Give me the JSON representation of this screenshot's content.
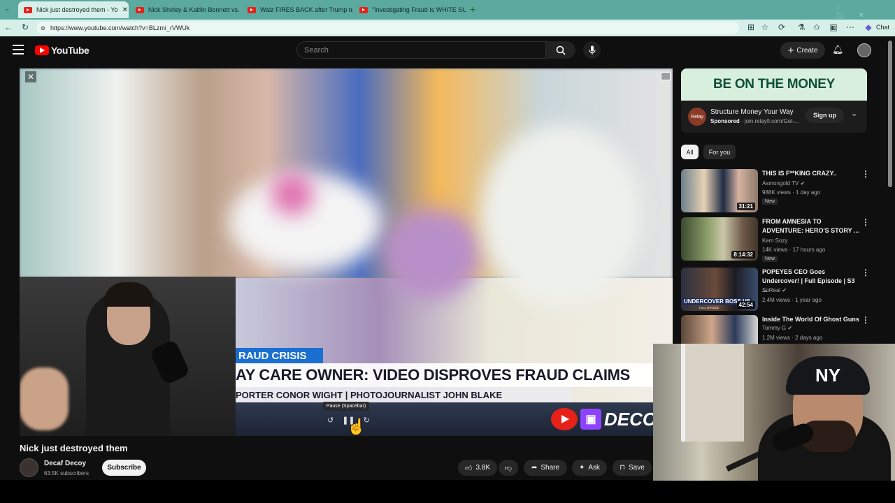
{
  "browser": {
    "tabs": [
      {
        "label": "Nick just destroyed them - Yo",
        "active": true
      },
      {
        "label": "Nick Shirley & Kaitlin Bennett vs. F",
        "active": false
      },
      {
        "label": "Walz FIRES BACK after Trump tear",
        "active": false
      },
      {
        "label": "\"Investigating Fraud Is WHITE SUF",
        "active": false
      }
    ],
    "new_tab": "+",
    "url": "https://www.youtube.com/watch?v=BLzmi_rVWUk",
    "chat_label": "Chat"
  },
  "youtube": {
    "logo_text": "YouTube",
    "search_placeholder": "Search",
    "create_label": "Create"
  },
  "video": {
    "overlay_tag": "RAUD CRISIS",
    "headline": "AY CARE OWNER: VIDEO DISPROVES FRAUD CLAIMS",
    "subline": "PORTER CONOR WIGHT | PHOTOJOURNALIST JOHN BLAKE",
    "watermark": "DECO",
    "tooltip": "Pause (Spacebar)",
    "title": "Nick just destroyed them",
    "channel_name": "Decaf Decoy",
    "subscribers": "63.5K subscribers",
    "subscribe_label": "Subscribe",
    "likes": "3.8K",
    "share_label": "Share",
    "ask_label": "Ask",
    "save_label": "Save"
  },
  "ad": {
    "banner": "BE ON THE MONEY",
    "logo_text": "Relay",
    "title": "Structure Money Your Way",
    "sponsored": "Sponsored",
    "domain": "· join.relayfi.com/Get-...",
    "signup_label": "Sign up"
  },
  "chips": [
    "All",
    "For you"
  ],
  "recommendations": [
    {
      "title": "THIS IS F**KING CRAZY..",
      "channel": "Asmongold TV",
      "meta": "988K views · 1 day ago",
      "duration": "31:21",
      "badge": "New"
    },
    {
      "title": "FROM AMNESIA TO ADVENTURE: HERO'S STORY ...",
      "channel": "Kem Sozy",
      "meta": "14K views · 17 hours ago",
      "duration": "8:14:32",
      "badge": "New"
    },
    {
      "title": "POPEYES CEO Goes Undercover! | Full Episode | S3 ...",
      "channel": "SoReal",
      "meta": "2.4M views · 1 year ago",
      "duration": "42:54",
      "badge": ""
    },
    {
      "title": "Inside The World Of Ghost Guns",
      "channel": "Tommy G",
      "meta": "1.2M views · 2 days ago",
      "duration": "",
      "badge": ""
    }
  ],
  "thumb_text": {
    "popeyes_overlay": "UNDERCOVER BOSS US",
    "popeyes_sub": "FULL EPISODE"
  },
  "webcam_cap_logo": "NY",
  "colors": {
    "tabbar": "#5ba99f",
    "youtube_red": "#ff0000",
    "dark_bg": "#0f0f0f",
    "banner_blue": "#1a6fd0"
  }
}
